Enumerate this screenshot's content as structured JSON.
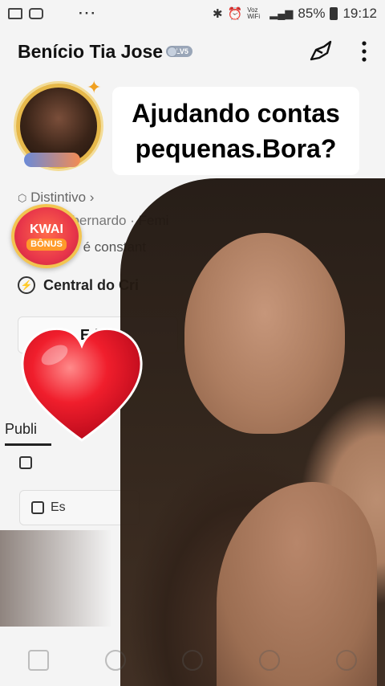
{
  "status_bar": {
    "overflow": "···",
    "network_label": "Voz WiFi",
    "battery": "85%",
    "time": "19:12"
  },
  "header": {
    "profile_name": "Benício Tia Jose",
    "level_badge": "LV5"
  },
  "promo_card": {
    "line1": "Ajudando contas",
    "line2": "pequenas.Bora?"
  },
  "profile": {
    "distinctive_label": "Distintivo",
    "meta_partial": "ebernardo · Femi",
    "bio_partial": "ão é constant",
    "creator_center": "Central do Cri",
    "edit_button": "Edita"
  },
  "kwai_bonus": {
    "line1": "KWAI",
    "line2": "BÔNUS"
  },
  "tabs": {
    "public": "Publi"
  },
  "explore_button": "Es"
}
